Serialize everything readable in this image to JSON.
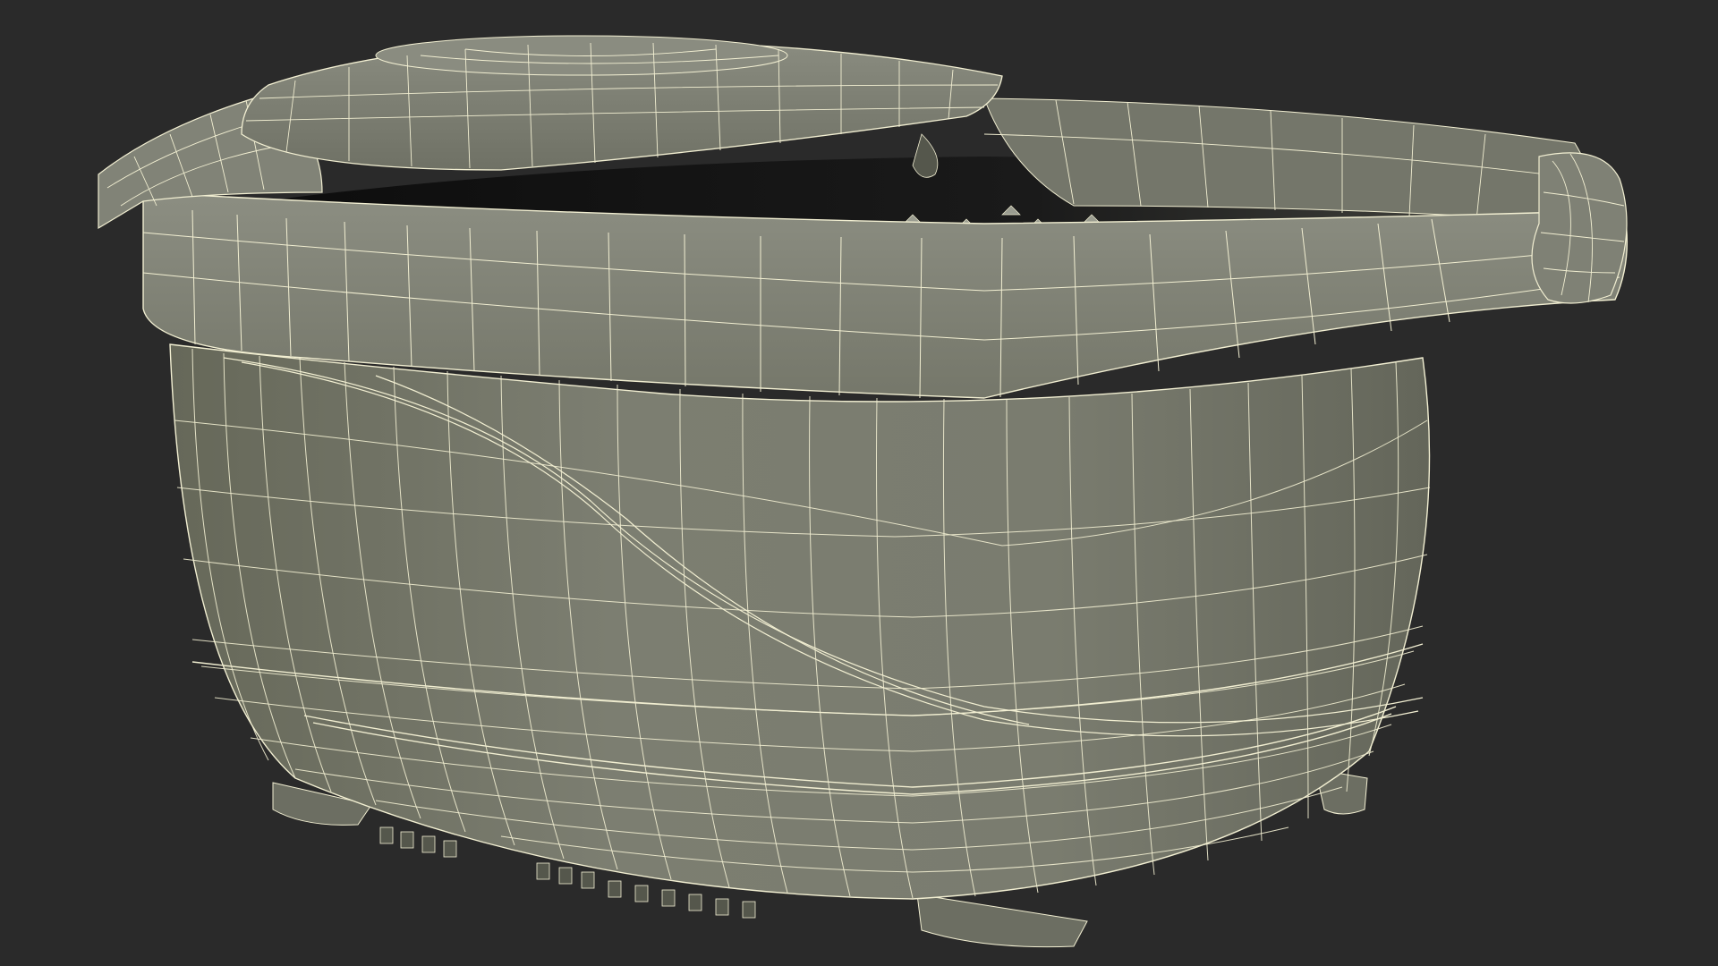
{
  "scene": {
    "subject": "foot-spa-basin-wireframe",
    "colors": {
      "background": "#2a2a2a",
      "surface": "#7b7d70",
      "surface_dark": "#6a6c60",
      "surface_light": "#8a8c80",
      "interior": "#101010",
      "wire": "#f2efd2"
    }
  }
}
